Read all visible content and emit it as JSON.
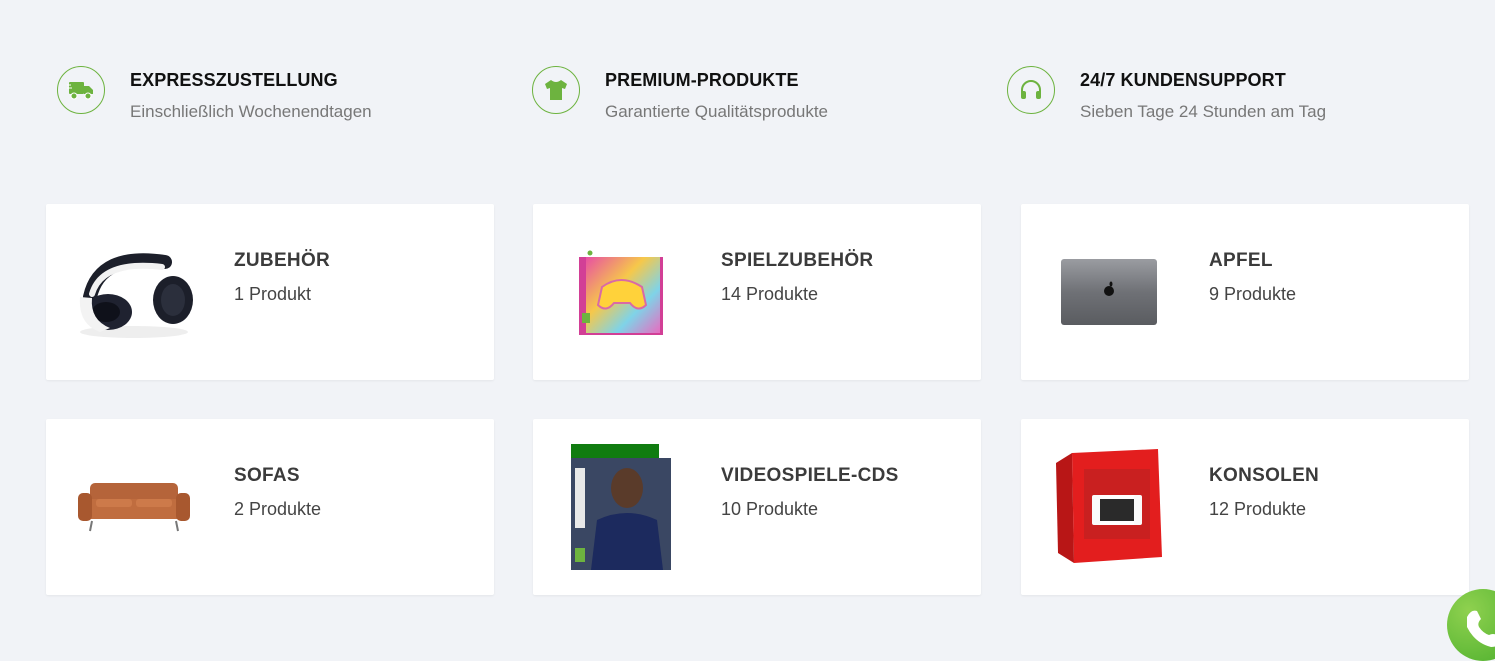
{
  "features": [
    {
      "icon": "truck-icon",
      "title": "EXPRESSZUSTELLUNG",
      "subtitle": "Einschließlich Wochenendtagen"
    },
    {
      "icon": "tshirt-icon",
      "title": "PREMIUM-PRODUKTE",
      "subtitle": "Garantierte Qualitätsprodukte"
    },
    {
      "icon": "headset-icon",
      "title": "24/7 KUNDENSUPPORT",
      "subtitle": "Sieben Tage 24 Stunden am Tag"
    }
  ],
  "categories": [
    {
      "title": "ZUBEHÖR",
      "count": "1 Produkt",
      "image": "headphones-image"
    },
    {
      "title": "SPIELZUBEHÖR",
      "count": "14 Produkte",
      "image": "controller-box-image"
    },
    {
      "title": "APFEL",
      "count": "9 Produkte",
      "image": "macbook-image"
    },
    {
      "title": "SOFAS",
      "count": "2 Produkte",
      "image": "sofa-image"
    },
    {
      "title": "VIDEOSPIELE-CDS",
      "count": "10 Produkte",
      "image": "game-cover-image"
    },
    {
      "title": "KONSOLEN",
      "count": "12 Produkte",
      "image": "switch-box-image"
    }
  ],
  "colors": {
    "accent": "#6db33f",
    "background": "#f1f3f7",
    "card": "#ffffff"
  }
}
